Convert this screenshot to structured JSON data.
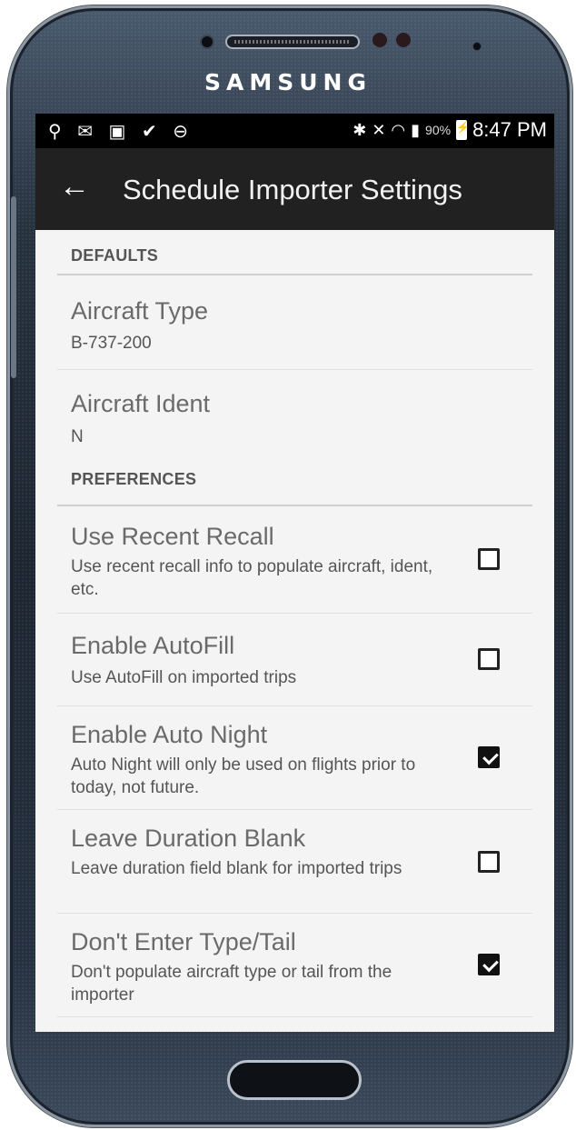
{
  "device": {
    "brand": "SAMSUNG"
  },
  "status_bar": {
    "left_icons": [
      "usb-icon",
      "message-icon",
      "calendar-icon",
      "clipboard-icon",
      "do-not-disturb-icon"
    ],
    "left_glyphs": "⚲ ✉ ▣ ✔ ⊖",
    "battery_percent": "90%",
    "time": "8:47 PM"
  },
  "app_bar": {
    "back_glyph": "←",
    "title": "Schedule Importer Settings"
  },
  "sections": {
    "defaults": {
      "header": "DEFAULTS"
    },
    "preferences": {
      "header": "PREFERENCES"
    }
  },
  "defaults": {
    "aircraft_type": {
      "title": "Aircraft Type",
      "value": "B-737-200"
    },
    "aircraft_ident": {
      "title": "Aircraft Ident",
      "value": "N"
    }
  },
  "preferences": {
    "use_recent_recall": {
      "title": "Use Recent Recall",
      "summary": "Use recent recall info to populate aircraft, ident, etc.",
      "checked": false
    },
    "enable_autofill": {
      "title": "Enable AutoFill",
      "summary": "Use AutoFill on imported trips",
      "checked": false
    },
    "enable_auto_night": {
      "title": "Enable Auto Night",
      "summary": "Auto Night will only be used on flights prior to today, not future.",
      "checked": true
    },
    "leave_duration_blank": {
      "title": "Leave Duration Blank",
      "summary": "Leave duration field blank for imported trips",
      "checked": false
    },
    "dont_enter_type_tail": {
      "title": "Don't Enter Type/Tail",
      "summary": "Don't populate aircraft type or tail from the importer",
      "checked": true
    }
  },
  "colors": {
    "app_bar": "#212121",
    "background": "#f4f4f4",
    "status_bar": "#000000"
  }
}
